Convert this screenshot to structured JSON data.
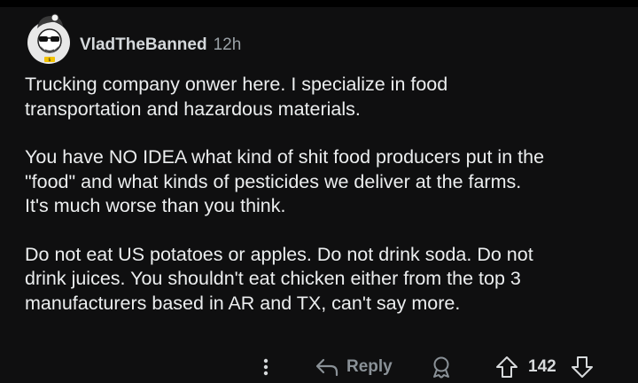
{
  "comment": {
    "author": "VladTheBanned",
    "age": "12h",
    "paragraphs": [
      "Trucking company onwer here. I specialize in food\ntransportation and hazardous materials.",
      "You have NO IDEA what kind of shit food producers put in the\n\"food\" and what kinds of pesticides we deliver at the farms.\nIt's much worse than you think.",
      "Do not eat US potatoes or apples. Do not drink soda. Do not\ndrink juices. You shouldn't eat chicken either from the top 3\nmanufacturers based in AR and TX, can't say more."
    ]
  },
  "actions": {
    "reply_label": "Reply",
    "score": "142"
  },
  "icons": {
    "avatar": "snoo-avatar-sunglasses",
    "more": "more-vertical-icon",
    "reply": "reply-arrow-icon",
    "award": "award-icon",
    "upvote": "upvote-arrow-icon",
    "downvote": "downvote-arrow-icon"
  },
  "colors": {
    "background": "#0f0f10",
    "text": "#eceeef",
    "muted": "#9aa1a6"
  }
}
